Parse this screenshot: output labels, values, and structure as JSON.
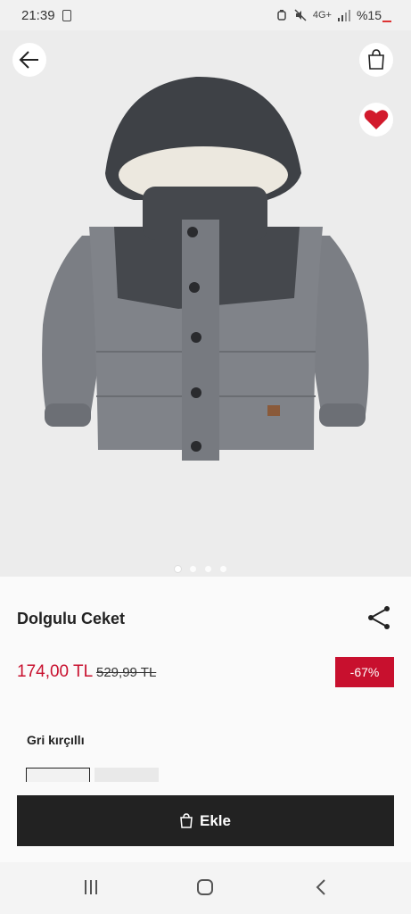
{
  "status_bar": {
    "time": "21:39",
    "network": "4G+",
    "battery": "%15"
  },
  "product": {
    "image_alt": "Dolgulu Ceket",
    "name": "Dolgulu Ceket",
    "price": "174,00 TL",
    "old_price": "529,99 TL",
    "discount": "-67%",
    "color_name": "Gri kırçıllı",
    "image_count": 4,
    "active_image_index": 0
  },
  "actions": {
    "add_label": "Ekle"
  },
  "colors": {
    "accent": "#c8102e",
    "button_bg": "#222222",
    "heart": "#d21a2c"
  },
  "icons": {
    "back": "arrow-left-icon",
    "bag": "shopping-bag-icon",
    "favorite": "heart-icon",
    "share": "share-icon",
    "add": "bag-icon",
    "recents": "recent-apps-icon",
    "home": "home-icon",
    "nav_back": "nav-back-icon"
  }
}
